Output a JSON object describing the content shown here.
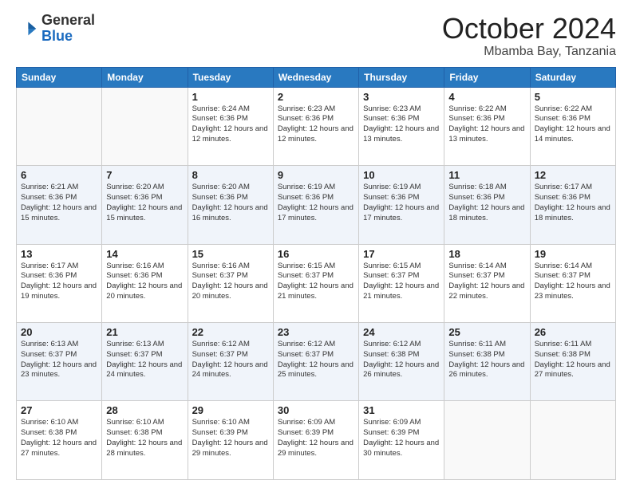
{
  "header": {
    "logo_general": "General",
    "logo_blue": "Blue",
    "month": "October 2024",
    "location": "Mbamba Bay, Tanzania"
  },
  "weekdays": [
    "Sunday",
    "Monday",
    "Tuesday",
    "Wednesday",
    "Thursday",
    "Friday",
    "Saturday"
  ],
  "weeks": [
    [
      {
        "day": null
      },
      {
        "day": null
      },
      {
        "day": "1",
        "sunrise": "6:24 AM",
        "sunset": "6:36 PM",
        "daylight": "12 hours and 12 minutes."
      },
      {
        "day": "2",
        "sunrise": "6:23 AM",
        "sunset": "6:36 PM",
        "daylight": "12 hours and 12 minutes."
      },
      {
        "day": "3",
        "sunrise": "6:23 AM",
        "sunset": "6:36 PM",
        "daylight": "12 hours and 13 minutes."
      },
      {
        "day": "4",
        "sunrise": "6:22 AM",
        "sunset": "6:36 PM",
        "daylight": "12 hours and 13 minutes."
      },
      {
        "day": "5",
        "sunrise": "6:22 AM",
        "sunset": "6:36 PM",
        "daylight": "12 hours and 14 minutes."
      }
    ],
    [
      {
        "day": "6",
        "sunrise": "6:21 AM",
        "sunset": "6:36 PM",
        "daylight": "12 hours and 15 minutes."
      },
      {
        "day": "7",
        "sunrise": "6:20 AM",
        "sunset": "6:36 PM",
        "daylight": "12 hours and 15 minutes."
      },
      {
        "day": "8",
        "sunrise": "6:20 AM",
        "sunset": "6:36 PM",
        "daylight": "12 hours and 16 minutes."
      },
      {
        "day": "9",
        "sunrise": "6:19 AM",
        "sunset": "6:36 PM",
        "daylight": "12 hours and 17 minutes."
      },
      {
        "day": "10",
        "sunrise": "6:19 AM",
        "sunset": "6:36 PM",
        "daylight": "12 hours and 17 minutes."
      },
      {
        "day": "11",
        "sunrise": "6:18 AM",
        "sunset": "6:36 PM",
        "daylight": "12 hours and 18 minutes."
      },
      {
        "day": "12",
        "sunrise": "6:17 AM",
        "sunset": "6:36 PM",
        "daylight": "12 hours and 18 minutes."
      }
    ],
    [
      {
        "day": "13",
        "sunrise": "6:17 AM",
        "sunset": "6:36 PM",
        "daylight": "12 hours and 19 minutes."
      },
      {
        "day": "14",
        "sunrise": "6:16 AM",
        "sunset": "6:36 PM",
        "daylight": "12 hours and 20 minutes."
      },
      {
        "day": "15",
        "sunrise": "6:16 AM",
        "sunset": "6:37 PM",
        "daylight": "12 hours and 20 minutes."
      },
      {
        "day": "16",
        "sunrise": "6:15 AM",
        "sunset": "6:37 PM",
        "daylight": "12 hours and 21 minutes."
      },
      {
        "day": "17",
        "sunrise": "6:15 AM",
        "sunset": "6:37 PM",
        "daylight": "12 hours and 21 minutes."
      },
      {
        "day": "18",
        "sunrise": "6:14 AM",
        "sunset": "6:37 PM",
        "daylight": "12 hours and 22 minutes."
      },
      {
        "day": "19",
        "sunrise": "6:14 AM",
        "sunset": "6:37 PM",
        "daylight": "12 hours and 23 minutes."
      }
    ],
    [
      {
        "day": "20",
        "sunrise": "6:13 AM",
        "sunset": "6:37 PM",
        "daylight": "12 hours and 23 minutes."
      },
      {
        "day": "21",
        "sunrise": "6:13 AM",
        "sunset": "6:37 PM",
        "daylight": "12 hours and 24 minutes."
      },
      {
        "day": "22",
        "sunrise": "6:12 AM",
        "sunset": "6:37 PM",
        "daylight": "12 hours and 24 minutes."
      },
      {
        "day": "23",
        "sunrise": "6:12 AM",
        "sunset": "6:37 PM",
        "daylight": "12 hours and 25 minutes."
      },
      {
        "day": "24",
        "sunrise": "6:12 AM",
        "sunset": "6:38 PM",
        "daylight": "12 hours and 26 minutes."
      },
      {
        "day": "25",
        "sunrise": "6:11 AM",
        "sunset": "6:38 PM",
        "daylight": "12 hours and 26 minutes."
      },
      {
        "day": "26",
        "sunrise": "6:11 AM",
        "sunset": "6:38 PM",
        "daylight": "12 hours and 27 minutes."
      }
    ],
    [
      {
        "day": "27",
        "sunrise": "6:10 AM",
        "sunset": "6:38 PM",
        "daylight": "12 hours and 27 minutes."
      },
      {
        "day": "28",
        "sunrise": "6:10 AM",
        "sunset": "6:38 PM",
        "daylight": "12 hours and 28 minutes."
      },
      {
        "day": "29",
        "sunrise": "6:10 AM",
        "sunset": "6:39 PM",
        "daylight": "12 hours and 29 minutes."
      },
      {
        "day": "30",
        "sunrise": "6:09 AM",
        "sunset": "6:39 PM",
        "daylight": "12 hours and 29 minutes."
      },
      {
        "day": "31",
        "sunrise": "6:09 AM",
        "sunset": "6:39 PM",
        "daylight": "12 hours and 30 minutes."
      },
      {
        "day": null
      },
      {
        "day": null
      }
    ]
  ]
}
